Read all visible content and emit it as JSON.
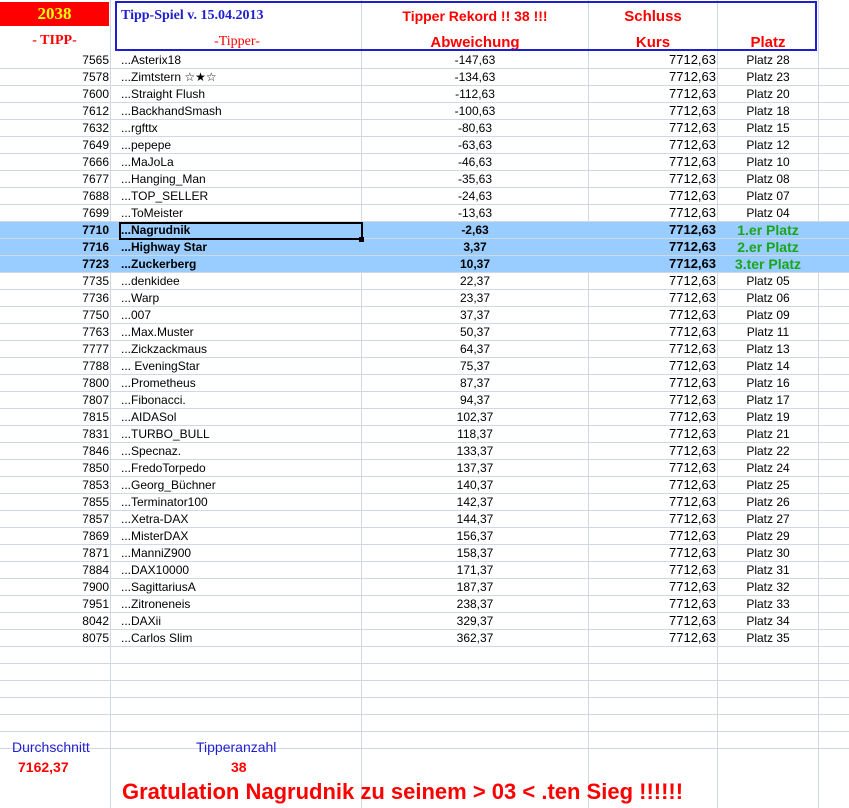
{
  "header": {
    "tipp_count": "2038",
    "title": "Tipp-Spiel v. 15.04.2013",
    "record": "Tipper Rekord !!  38  !!!",
    "schluss": "Schluss",
    "col_tipp": "- TIPP-",
    "col_tipper": "-Tipper-",
    "col_abweichung": "Abweichung",
    "col_kurs": "Kurs",
    "col_platz": "Platz"
  },
  "rows": [
    {
      "tipp": "7565",
      "name": "...Asterix18",
      "dev": "-147,63",
      "kurs": "7712,63",
      "platz": "Platz 28"
    },
    {
      "tipp": "7578",
      "name": "...Zimtstern ☆★☆",
      "dev": "-134,63",
      "kurs": "7712,63",
      "platz": "Platz 23"
    },
    {
      "tipp": "7600",
      "name": "...Straight Flush",
      "dev": "-112,63",
      "kurs": "7712,63",
      "platz": "Platz 20"
    },
    {
      "tipp": "7612",
      "name": "...BackhandSmash",
      "dev": "-100,63",
      "kurs": "7712,63",
      "platz": "Platz 18"
    },
    {
      "tipp": "7632",
      "name": "...rgfttx",
      "dev": "-80,63",
      "kurs": "7712,63",
      "platz": "Platz 15"
    },
    {
      "tipp": "7649",
      "name": "...pepepe",
      "dev": "-63,63",
      "kurs": "7712,63",
      "platz": "Platz 12"
    },
    {
      "tipp": "7666",
      "name": "...MaJoLa",
      "dev": "-46,63",
      "kurs": "7712,63",
      "platz": "Platz 10"
    },
    {
      "tipp": "7677",
      "name": "...Hanging_Man",
      "dev": "-35,63",
      "kurs": "7712,63",
      "platz": "Platz 08"
    },
    {
      "tipp": "7688",
      "name": "...TOP_SELLER",
      "dev": "-24,63",
      "kurs": "7712,63",
      "platz": "Platz 07"
    },
    {
      "tipp": "7699",
      "name": "...ToMeister",
      "dev": "-13,63",
      "kurs": "7712,63",
      "platz": "Platz 04"
    },
    {
      "tipp": "7710",
      "name": "...Nagrudnik",
      "dev": "-2,63",
      "kurs": "7712,63",
      "platz": "1.er Platz",
      "highlight": true
    },
    {
      "tipp": "7716",
      "name": "...Highway Star",
      "dev": "3,37",
      "kurs": "7712,63",
      "platz": "2.er Platz",
      "highlight": true
    },
    {
      "tipp": "7723",
      "name": "...Zuckerberg",
      "dev": "10,37",
      "kurs": "7712,63",
      "platz": "3.ter Platz",
      "highlight": true
    },
    {
      "tipp": "7735",
      "name": "...denkidee",
      "dev": "22,37",
      "kurs": "7712,63",
      "platz": "Platz 05"
    },
    {
      "tipp": "7736",
      "name": "...Warp",
      "dev": "23,37",
      "kurs": "7712,63",
      "platz": "Platz 06"
    },
    {
      "tipp": "7750",
      "name": "...007",
      "dev": "37,37",
      "kurs": "7712,63",
      "platz": "Platz 09"
    },
    {
      "tipp": "7763",
      "name": "...Max.Muster",
      "dev": "50,37",
      "kurs": "7712,63",
      "platz": "Platz 11"
    },
    {
      "tipp": "7777",
      "name": "...Zickzackmaus",
      "dev": "64,37",
      "kurs": "7712,63",
      "platz": "Platz 13"
    },
    {
      "tipp": "7788",
      "name": "... EveningStar",
      "dev": "75,37",
      "kurs": "7712,63",
      "platz": "Platz 14"
    },
    {
      "tipp": "7800",
      "name": "...Prometheus",
      "dev": "87,37",
      "kurs": "7712,63",
      "platz": "Platz 16"
    },
    {
      "tipp": "7807",
      "name": "...Fibonacci.",
      "dev": "94,37",
      "kurs": "7712,63",
      "platz": "Platz 17"
    },
    {
      "tipp": "7815",
      "name": "...AIDASol",
      "dev": "102,37",
      "kurs": "7712,63",
      "platz": "Platz 19"
    },
    {
      "tipp": "7831",
      "name": "...TURBO_BULL",
      "dev": "118,37",
      "kurs": "7712,63",
      "platz": "Platz 21"
    },
    {
      "tipp": "7846",
      "name": "...Specnaz.",
      "dev": "133,37",
      "kurs": "7712,63",
      "platz": "Platz 22"
    },
    {
      "tipp": "7850",
      "name": "...FredoTorpedo",
      "dev": "137,37",
      "kurs": "7712,63",
      "platz": "Platz 24"
    },
    {
      "tipp": "7853",
      "name": "...Georg_Büchner",
      "dev": "140,37",
      "kurs": "7712,63",
      "platz": "Platz 25"
    },
    {
      "tipp": "7855",
      "name": "...Terminator100",
      "dev": "142,37",
      "kurs": "7712,63",
      "platz": "Platz 26"
    },
    {
      "tipp": "7857",
      "name": "...Xetra-DAX",
      "dev": "144,37",
      "kurs": "7712,63",
      "platz": "Platz 27"
    },
    {
      "tipp": "7869",
      "name": "...MisterDAX",
      "dev": "156,37",
      "kurs": "7712,63",
      "platz": "Platz 29"
    },
    {
      "tipp": "7871",
      "name": "...ManniZ900",
      "dev": "158,37",
      "kurs": "7712,63",
      "platz": "Platz 30"
    },
    {
      "tipp": "7884",
      "name": "...DAX10000",
      "dev": "171,37",
      "kurs": "7712,63",
      "platz": "Platz 31"
    },
    {
      "tipp": "7900",
      "name": "...SagittariusA",
      "dev": "187,37",
      "kurs": "7712,63",
      "platz": "Platz 32"
    },
    {
      "tipp": "7951",
      "name": "...Zitroneneis",
      "dev": "238,37",
      "kurs": "7712,63",
      "platz": "Platz 33"
    },
    {
      "tipp": "8042",
      "name": "...DAXii",
      "dev": "329,37",
      "kurs": "7712,63",
      "platz": "Platz 34"
    },
    {
      "tipp": "8075",
      "name": "...Carlos Slim",
      "dev": "362,37",
      "kurs": "7712,63",
      "platz": "Platz 35"
    }
  ],
  "footer": {
    "avg_label": "Durchschnitt",
    "avg_value": "7162,37",
    "count_label": "Tipperanzahl",
    "count_value": "38",
    "congrats": "Gratulation Nagrudnik zu seinem > 03 < .ten Sieg !!!!!!"
  },
  "colors": {
    "red_header": "#ff0000",
    "frame_blue": "#1f1fd0",
    "highlight": "#99ccff",
    "green_rank": "#1aa51a"
  }
}
